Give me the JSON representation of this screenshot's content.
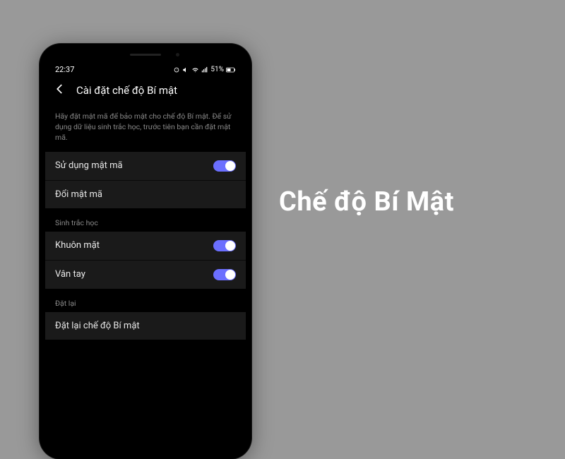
{
  "status": {
    "time": "22:37",
    "battery": "51%"
  },
  "header": {
    "title": "Cài đặt chế độ Bí mật"
  },
  "description": "Hãy đặt mật mã để bảo mật cho chế độ Bí mật. Để sử dụng dữ liệu sinh trắc học, trước tiên bạn cần đặt mật mã.",
  "settings": {
    "use_passcode": "Sử dụng mật mã",
    "change_passcode": "Đổi mật mã"
  },
  "sections": {
    "biometric": {
      "header": "Sinh trắc học",
      "face": "Khuôn mặt",
      "fingerprint": "Vân tay"
    },
    "reset": {
      "header": "Đặt lại",
      "reset_secret": "Đặt lại chế độ Bí mật"
    }
  },
  "headline": "Chế độ Bí Mật"
}
